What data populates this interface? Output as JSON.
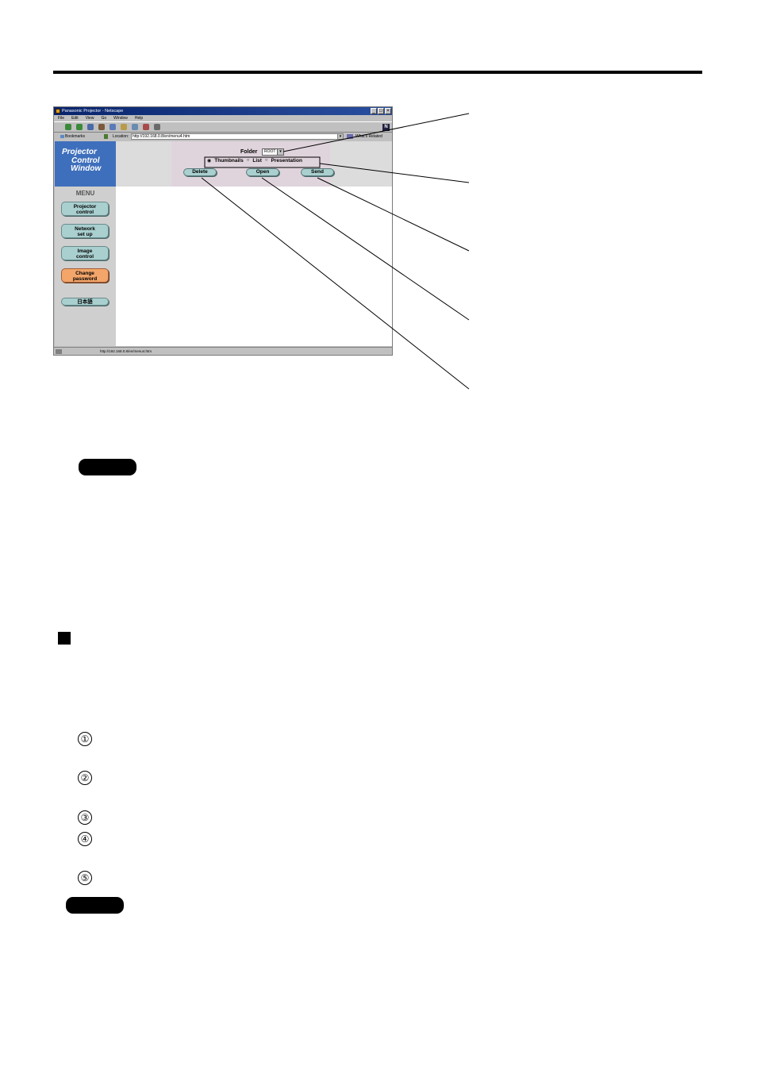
{
  "browser": {
    "window_title": "Panasonic Projector - Netscape",
    "window_buttons": [
      "_",
      "□",
      "×"
    ],
    "menu": [
      "File",
      "Edit",
      "View",
      "Go",
      "Window",
      "Help"
    ],
    "bookmarks_label": "Bookmarks",
    "location_label": "Location:",
    "url": "http://192.168.0.8/en/menu4.htm",
    "related_label": "What's Related",
    "status_url": "http://192.168.0.8/en/menu4.htm"
  },
  "sidebar": {
    "logo_lines": [
      "Projector",
      "Control",
      "Window"
    ],
    "menu_title": "MENU",
    "buttons": [
      {
        "line1": "Projector",
        "line2": "control"
      },
      {
        "line1": "Network",
        "line2": "set up"
      },
      {
        "line1": "Image",
        "line2": "control"
      },
      {
        "line1": "Change",
        "line2": "password"
      },
      {
        "line1": "日本語",
        "line2": ""
      }
    ]
  },
  "main": {
    "folder_label": "Folder",
    "folder_value": "ROOT",
    "view_options": [
      "Thumbnails",
      "List",
      "Presentation"
    ],
    "selected_view": "Thumbnails",
    "actions": [
      "Delete",
      "Open",
      "Send"
    ]
  },
  "steps": [
    "①",
    "②",
    "③",
    "④",
    "⑤"
  ]
}
